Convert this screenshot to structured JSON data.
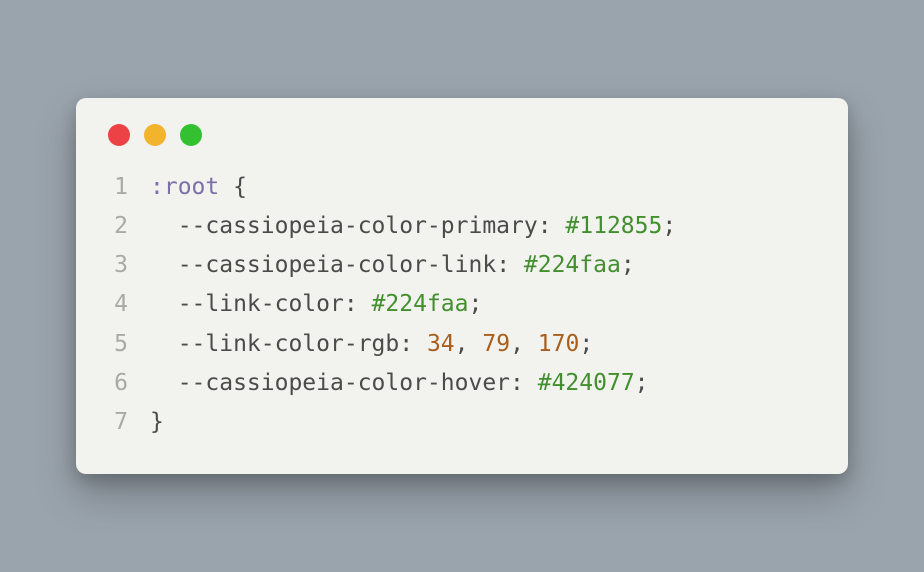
{
  "window": {
    "controls": {
      "close": "red",
      "minimize": "yellow",
      "zoom": "green"
    }
  },
  "code": {
    "language": "css",
    "lines": [
      {
        "num": "1",
        "tokens": [
          {
            "t": ":root ",
            "c": "sel"
          },
          {
            "t": "{",
            "c": "punc"
          }
        ]
      },
      {
        "num": "2",
        "indent": 1,
        "tokens": [
          {
            "t": "--cassiopeia-color-primary",
            "c": "prop"
          },
          {
            "t": ": ",
            "c": "punc"
          },
          {
            "t": "#112855",
            "c": "val"
          },
          {
            "t": ";",
            "c": "punc"
          }
        ]
      },
      {
        "num": "3",
        "indent": 1,
        "tokens": [
          {
            "t": "--cassiopeia-color-link",
            "c": "prop"
          },
          {
            "t": ": ",
            "c": "punc"
          },
          {
            "t": "#224faa",
            "c": "val"
          },
          {
            "t": ";",
            "c": "punc"
          }
        ]
      },
      {
        "num": "4",
        "indent": 1,
        "tokens": [
          {
            "t": "--link-color",
            "c": "prop"
          },
          {
            "t": ": ",
            "c": "punc"
          },
          {
            "t": "#224faa",
            "c": "val"
          },
          {
            "t": ";",
            "c": "punc"
          }
        ]
      },
      {
        "num": "5",
        "indent": 1,
        "tokens": [
          {
            "t": "--link-color-rgb",
            "c": "prop"
          },
          {
            "t": ": ",
            "c": "punc"
          },
          {
            "t": "34",
            "c": "num"
          },
          {
            "t": ", ",
            "c": "punc"
          },
          {
            "t": "79",
            "c": "num"
          },
          {
            "t": ", ",
            "c": "punc"
          },
          {
            "t": "170",
            "c": "num"
          },
          {
            "t": ";",
            "c": "punc"
          }
        ]
      },
      {
        "num": "6",
        "indent": 1,
        "tokens": [
          {
            "t": "--cassiopeia-color-hover",
            "c": "prop"
          },
          {
            "t": ": ",
            "c": "punc"
          },
          {
            "t": "#424077",
            "c": "val"
          },
          {
            "t": ";",
            "c": "punc"
          }
        ]
      },
      {
        "num": "7",
        "tokens": [
          {
            "t": "}",
            "c": "punc"
          }
        ]
      }
    ]
  }
}
